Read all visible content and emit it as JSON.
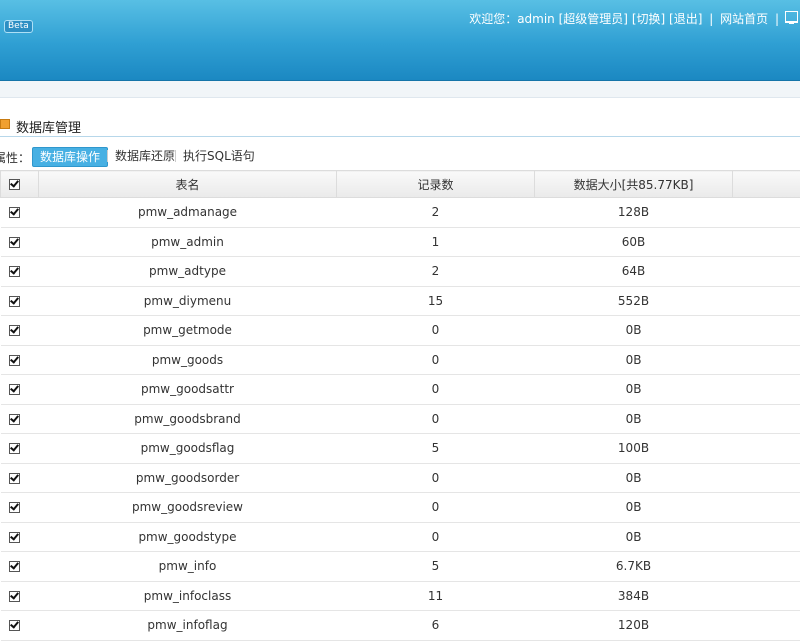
{
  "header": {
    "beta_badge": "Beta",
    "welcome": "欢迎您：admin",
    "role": "[超级管理员]",
    "switch": "[切换]",
    "logout": "[退出]",
    "site_home": "网站首页"
  },
  "section": {
    "title": "数据库管理"
  },
  "toolbar": {
    "attr_label": "属性：",
    "tab_db_ops": "数据库操作",
    "tab_db_restore": "数据库还原",
    "tab_sql": "执行SQL语句"
  },
  "table": {
    "col_name": "表名",
    "col_records": "记录数",
    "col_size": "数据大小[共85.77KB]",
    "rows": [
      {
        "name": "pmw_admanage",
        "records": "2",
        "size": "128B"
      },
      {
        "name": "pmw_admin",
        "records": "1",
        "size": "60B"
      },
      {
        "name": "pmw_adtype",
        "records": "2",
        "size": "64B"
      },
      {
        "name": "pmw_diymenu",
        "records": "15",
        "size": "552B"
      },
      {
        "name": "pmw_getmode",
        "records": "0",
        "size": "0B"
      },
      {
        "name": "pmw_goods",
        "records": "0",
        "size": "0B"
      },
      {
        "name": "pmw_goodsattr",
        "records": "0",
        "size": "0B"
      },
      {
        "name": "pmw_goodsbrand",
        "records": "0",
        "size": "0B"
      },
      {
        "name": "pmw_goodsflag",
        "records": "5",
        "size": "100B"
      },
      {
        "name": "pmw_goodsorder",
        "records": "0",
        "size": "0B"
      },
      {
        "name": "pmw_goodsreview",
        "records": "0",
        "size": "0B"
      },
      {
        "name": "pmw_goodstype",
        "records": "0",
        "size": "0B"
      },
      {
        "name": "pmw_info",
        "records": "5",
        "size": "6.7KB"
      },
      {
        "name": "pmw_infoclass",
        "records": "11",
        "size": "384B"
      },
      {
        "name": "pmw_infoflag",
        "records": "6",
        "size": "120B"
      }
    ]
  }
}
